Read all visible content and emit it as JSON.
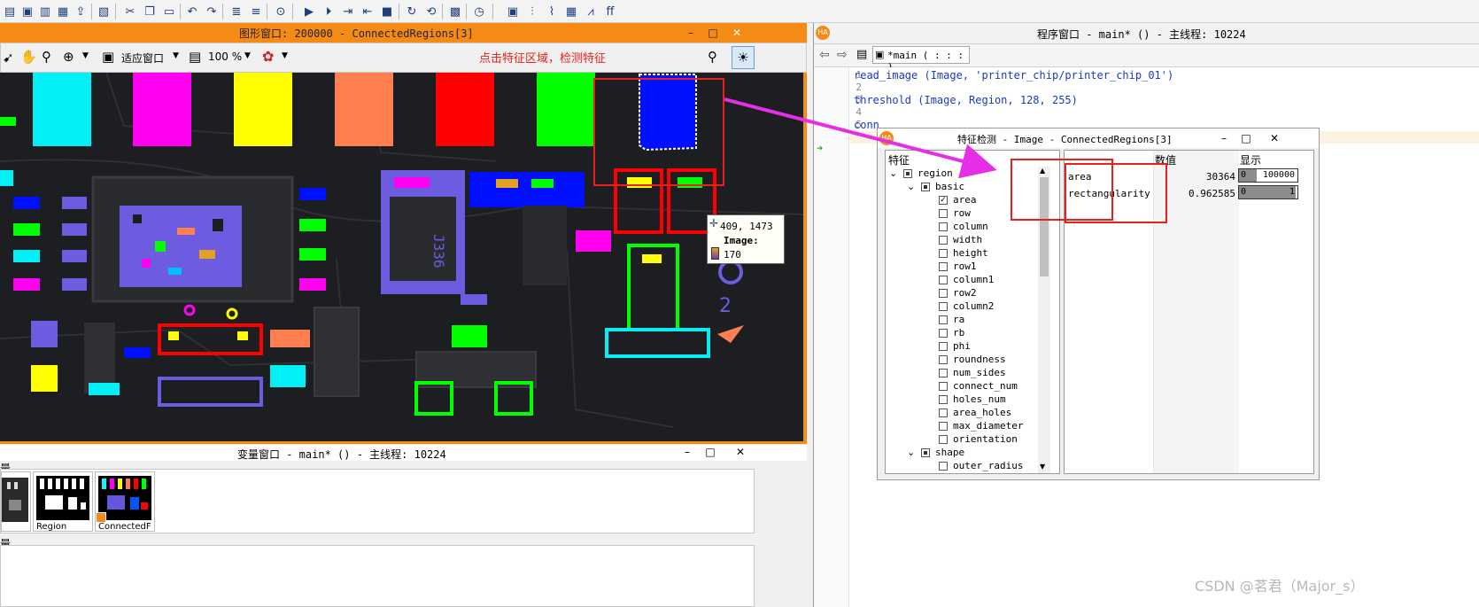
{
  "toolbar": {
    "icons": [
      "open-image-icon",
      "open-program-icon",
      "save-icon",
      "save-all-icon",
      "export-icon",
      "properties-icon",
      "cut-icon",
      "copy-icon",
      "paste-icon",
      "undo-icon",
      "redo-icon",
      "format-icon",
      "format-alt-icon",
      "find-icon",
      "run-icon",
      "step-over-icon",
      "step-into-icon",
      "step-out-icon",
      "stop-icon",
      "reset-icon",
      "reset-all-icon",
      "load-icon",
      "profiler-icon",
      "image-tools-icon",
      "histogram-icon",
      "line-profile-icon",
      "region-features-icon",
      "gray-features-icon",
      "ocr-icon"
    ]
  },
  "graphics_window": {
    "title": "图形窗口: 200000 - ConnectedRegions[3]",
    "zoom_mode": "适应窗口",
    "zoom_level": "100 %",
    "annotation": "点击特征区域，检测特征",
    "pixel_info": {
      "coords": "409, 1473",
      "label": "Image:",
      "value": "170"
    }
  },
  "program_window": {
    "title": "程序窗口 - main* () - 主线程: 10224",
    "procedure_selector": "*main ( : : : )",
    "lines": [
      {
        "num": "1",
        "code": "read_image (Image, 'printer_chip/printer_chip_01')"
      },
      {
        "num": "2",
        "code": ""
      },
      {
        "num": "3",
        "code": "threshold (Image, Region, 128, 255)"
      },
      {
        "num": "4",
        "code": ""
      },
      {
        "num": "5",
        "code": "conn"
      },
      {
        "num": "6",
        "code": ""
      }
    ]
  },
  "feature_dialog": {
    "title": "特征检测 - Image - ConnectedRegions[3]",
    "tree_header": "特征",
    "tree": [
      {
        "label": "region",
        "level": 0,
        "expanded": true,
        "check": "partial"
      },
      {
        "label": "basic",
        "level": 1,
        "expanded": true,
        "check": "partial"
      },
      {
        "label": "area",
        "level": 2,
        "check": "checked"
      },
      {
        "label": "row",
        "level": 2,
        "check": "none"
      },
      {
        "label": "column",
        "level": 2,
        "check": "none"
      },
      {
        "label": "width",
        "level": 2,
        "check": "none"
      },
      {
        "label": "height",
        "level": 2,
        "check": "none"
      },
      {
        "label": "row1",
        "level": 2,
        "check": "none"
      },
      {
        "label": "column1",
        "level": 2,
        "check": "none"
      },
      {
        "label": "row2",
        "level": 2,
        "check": "none"
      },
      {
        "label": "column2",
        "level": 2,
        "check": "none"
      },
      {
        "label": "ra",
        "level": 2,
        "check": "none"
      },
      {
        "label": "rb",
        "level": 2,
        "check": "none"
      },
      {
        "label": "phi",
        "level": 2,
        "check": "none"
      },
      {
        "label": "roundness",
        "level": 2,
        "check": "none"
      },
      {
        "label": "num_sides",
        "level": 2,
        "check": "none"
      },
      {
        "label": "connect_num",
        "level": 2,
        "check": "none"
      },
      {
        "label": "holes_num",
        "level": 2,
        "check": "none"
      },
      {
        "label": "area_holes",
        "level": 2,
        "check": "none"
      },
      {
        "label": "max_diameter",
        "level": 2,
        "check": "none"
      },
      {
        "label": "orientation",
        "level": 2,
        "check": "none"
      },
      {
        "label": "shape",
        "level": 1,
        "expanded": true,
        "check": "partial"
      },
      {
        "label": "outer_radius",
        "level": 2,
        "check": "none"
      }
    ],
    "table_headers": {
      "name": "",
      "value": "数值",
      "display": "显示"
    },
    "rows": [
      {
        "name": "area",
        "value": "30364",
        "min": "0",
        "max": "100000",
        "fill": 0.30364
      },
      {
        "name": "rectangularity",
        "value": "0.962585",
        "min": "0",
        "max": "1",
        "fill": 0.962585
      }
    ]
  },
  "variable_window": {
    "title": "变量窗口 - main* () - 主线程: 10224",
    "section_label_top": "量",
    "section_label_bottom": "量",
    "thumbnails": [
      {
        "label": "",
        "kind": "image"
      },
      {
        "label": "Region",
        "kind": "region"
      },
      {
        "label": "ConnectedF",
        "kind": "connected"
      }
    ]
  },
  "watermark": "CSDN @茗君（Major_s）",
  "colors": {
    "accent_orange": "#f58a15",
    "annotation_red": "#e8221a",
    "arrow_magenta": "#e62ee6",
    "code_blue": "#1b39c4"
  }
}
